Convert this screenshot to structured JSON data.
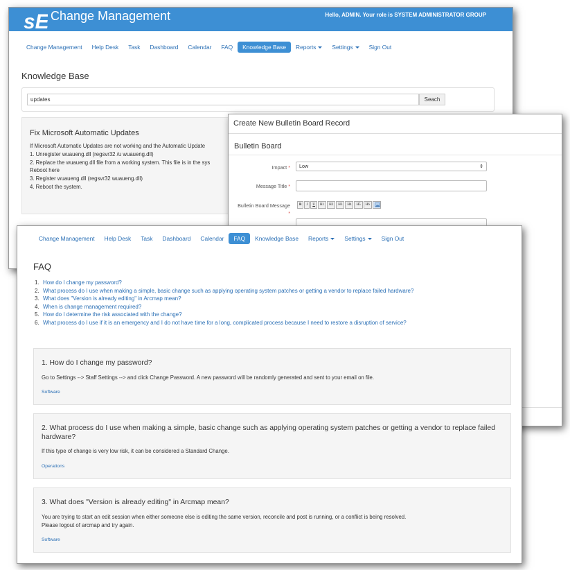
{
  "kb_window": {
    "app_title": "Change Management",
    "greeting": "Hello, ADMIN. Your role is SYSTEM ADMINISTRATOR GROUP",
    "nav": [
      {
        "label": "Change Management"
      },
      {
        "label": "Help Desk"
      },
      {
        "label": "Task"
      },
      {
        "label": "Dashboard"
      },
      {
        "label": "Calendar"
      },
      {
        "label": "FAQ"
      },
      {
        "label": "Knowledge Base"
      },
      {
        "label": "Reports"
      },
      {
        "label": "Settings"
      },
      {
        "label": "Sign Out"
      }
    ],
    "active_nav": "Knowledge Base",
    "page_title": "Knowledge Base",
    "search": {
      "value": "updates",
      "button_label": "Seach"
    },
    "article": {
      "title": "Fix Microsoft Automatic Updates",
      "lines": [
        "If Microsoft Automatic Updates are not working and the Automatic Update",
        "1. Unregister wuaueng.dll (regsvr32 /u wuaueng.dll)",
        "2. Replace the wuaueng.dll file from a working system. This file is in the sys",
        "Reboot here",
        "3. Register wuaueng.dll (regsvr32 wuaueng.dll)",
        "4. Reboot the system."
      ]
    }
  },
  "bulletin_window": {
    "title": "Create New Bulletin Board Record",
    "subtitle": "Bulletin Board",
    "fields": {
      "impact_label": "Impact",
      "impact_value": "Low",
      "message_title_label": "Message Title",
      "message_label": "Bulletin Board Message"
    },
    "toolbar": [
      "B",
      "I",
      "U",
      "H1",
      "H2",
      "H3",
      "H4",
      "H5",
      "H6"
    ]
  },
  "faq_window": {
    "nav": [
      {
        "label": "Change Management"
      },
      {
        "label": "Help Desk"
      },
      {
        "label": "Task"
      },
      {
        "label": "Dashboard"
      },
      {
        "label": "Calendar"
      },
      {
        "label": "FAQ"
      },
      {
        "label": "Knowledge Base"
      },
      {
        "label": "Reports"
      },
      {
        "label": "Settings"
      },
      {
        "label": "Sign Out"
      }
    ],
    "active_nav": "FAQ",
    "page_title": "FAQ",
    "questions": [
      {
        "num": "1.",
        "text": "How do I change my password?"
      },
      {
        "num": "2.",
        "text": "What process do I use when making a simple, basic change such as applying operating system patches or getting a vendor to replace failed hardware?"
      },
      {
        "num": "3.",
        "text": "What does \"Version is already editing\" in Arcmap mean?"
      },
      {
        "num": "4.",
        "text": "When is change management required?"
      },
      {
        "num": "5.",
        "text": "How do I determine the risk associated with the change?"
      },
      {
        "num": "6.",
        "text": "What process do I use if it is an emergency and I do not have time for a long, complicated process because I need to restore a disruption of service?"
      }
    ],
    "cards": [
      {
        "question": "1. How do I change my password?",
        "answer": [
          "Go to Settings --> Staff Settings --> and click Change Password. A new password will be randomly generated and sent to your email on file."
        ],
        "tag": "Software"
      },
      {
        "question": "2. What process do I use when making a simple, basic change such as applying operating system patches or getting a vendor to replace failed hardware?",
        "answer": [
          "If this type of change is very low risk, it can be considered a Standard Change."
        ],
        "tag": "Operations"
      },
      {
        "question": "3. What does \"Version is already editing\" in Arcmap mean?",
        "answer": [
          "You are trying to start an edit session when either someone else is editing the same version, reconcile and post is running, or a conflict is being resolved.",
          "Please logout of arcmap and try again."
        ],
        "tag": "Software"
      }
    ]
  },
  "colors": {
    "brand": "#3d8fd4",
    "link": "#2a6fb5",
    "panel": "#f5f5f5",
    "required": "#d9534f"
  },
  "icons": [
    "se-logo-icon",
    "caret-down-icon",
    "select-arrow-icon",
    "image-icon"
  ]
}
